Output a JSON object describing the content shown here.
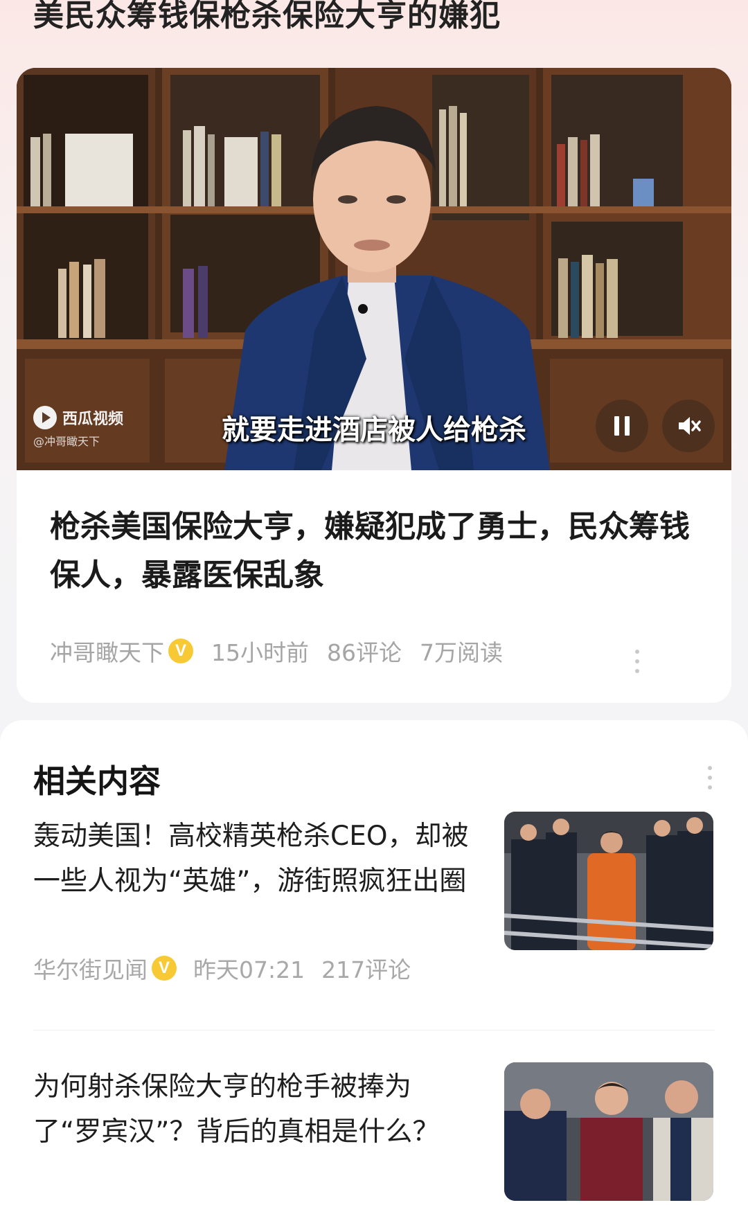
{
  "header": {
    "title": "美民众筹钱保枪杀保险大亨的嫌犯"
  },
  "video": {
    "brand": "西瓜视频",
    "handle": "@冲哥瞰天下",
    "subtitle": "就要走进酒店被人给枪杀"
  },
  "article": {
    "title": "枪杀美国保险大亨，嫌疑犯成了勇士，民众筹钱保人，暴露医保乱象",
    "author": "冲哥瞰天下",
    "verified": "V",
    "time": "15小时前",
    "comments": "86评论",
    "reads": "7万阅读"
  },
  "related": {
    "title": "相关内容",
    "items": [
      {
        "title": "轰动美国！高校精英枪杀CEO，却被一些人视为“英雄”，游街照疯狂出圈",
        "source": "华尔街见闻",
        "verified": "V",
        "time": "昨天07:21",
        "comments": "217评论"
      },
      {
        "title": "为何射杀保险大亨的枪手被捧为了“罗宾汉”？背后的真相是什么？"
      }
    ]
  },
  "colors": {
    "badge": "#f7c935",
    "meta": "#a5a5a5"
  }
}
